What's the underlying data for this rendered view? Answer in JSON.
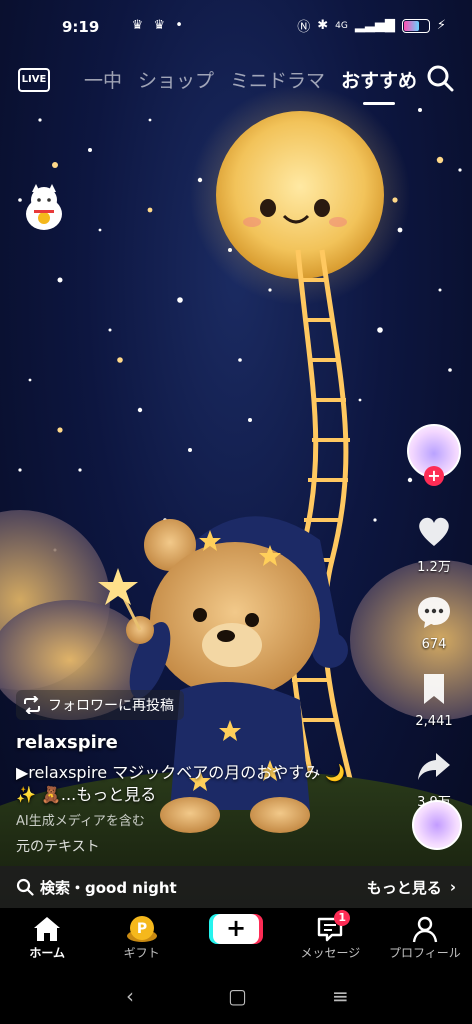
{
  "status_bar": {
    "time": "9:19",
    "network": "4G"
  },
  "top_nav": {
    "live_label": "LIVE",
    "tabs": [
      {
        "label": "一中"
      },
      {
        "label": "ショップ"
      },
      {
        "label": "ミニドラマ"
      },
      {
        "label": "おすすめ",
        "active": true
      }
    ]
  },
  "rail": {
    "like_count": "1.2万",
    "comment_count": "674",
    "save_count": "2,441",
    "share_count": "3.9万"
  },
  "post": {
    "repost_label": "フォロワーに再投稿",
    "username": "relaxspire",
    "caption_line1": "▶relaxspire マジックベアの月のおやすみ 🌙",
    "caption_line2": "✨ 🧸...もっと見る",
    "ai_label": "AI生成メディアを含む",
    "original_text": "元のテキスト"
  },
  "search_suggestion": {
    "text": "検索・good night",
    "more": "もっと見る"
  },
  "bottom_nav": {
    "home": "ホーム",
    "gift": "ギフト",
    "messages": "メッセージ",
    "messages_badge": "1",
    "profile": "プロフィール"
  },
  "colors": {
    "accent_red": "#fe2c55",
    "accent_cyan": "#25f4ee",
    "moon": "#f2c35a",
    "sky": "#0d1640"
  }
}
